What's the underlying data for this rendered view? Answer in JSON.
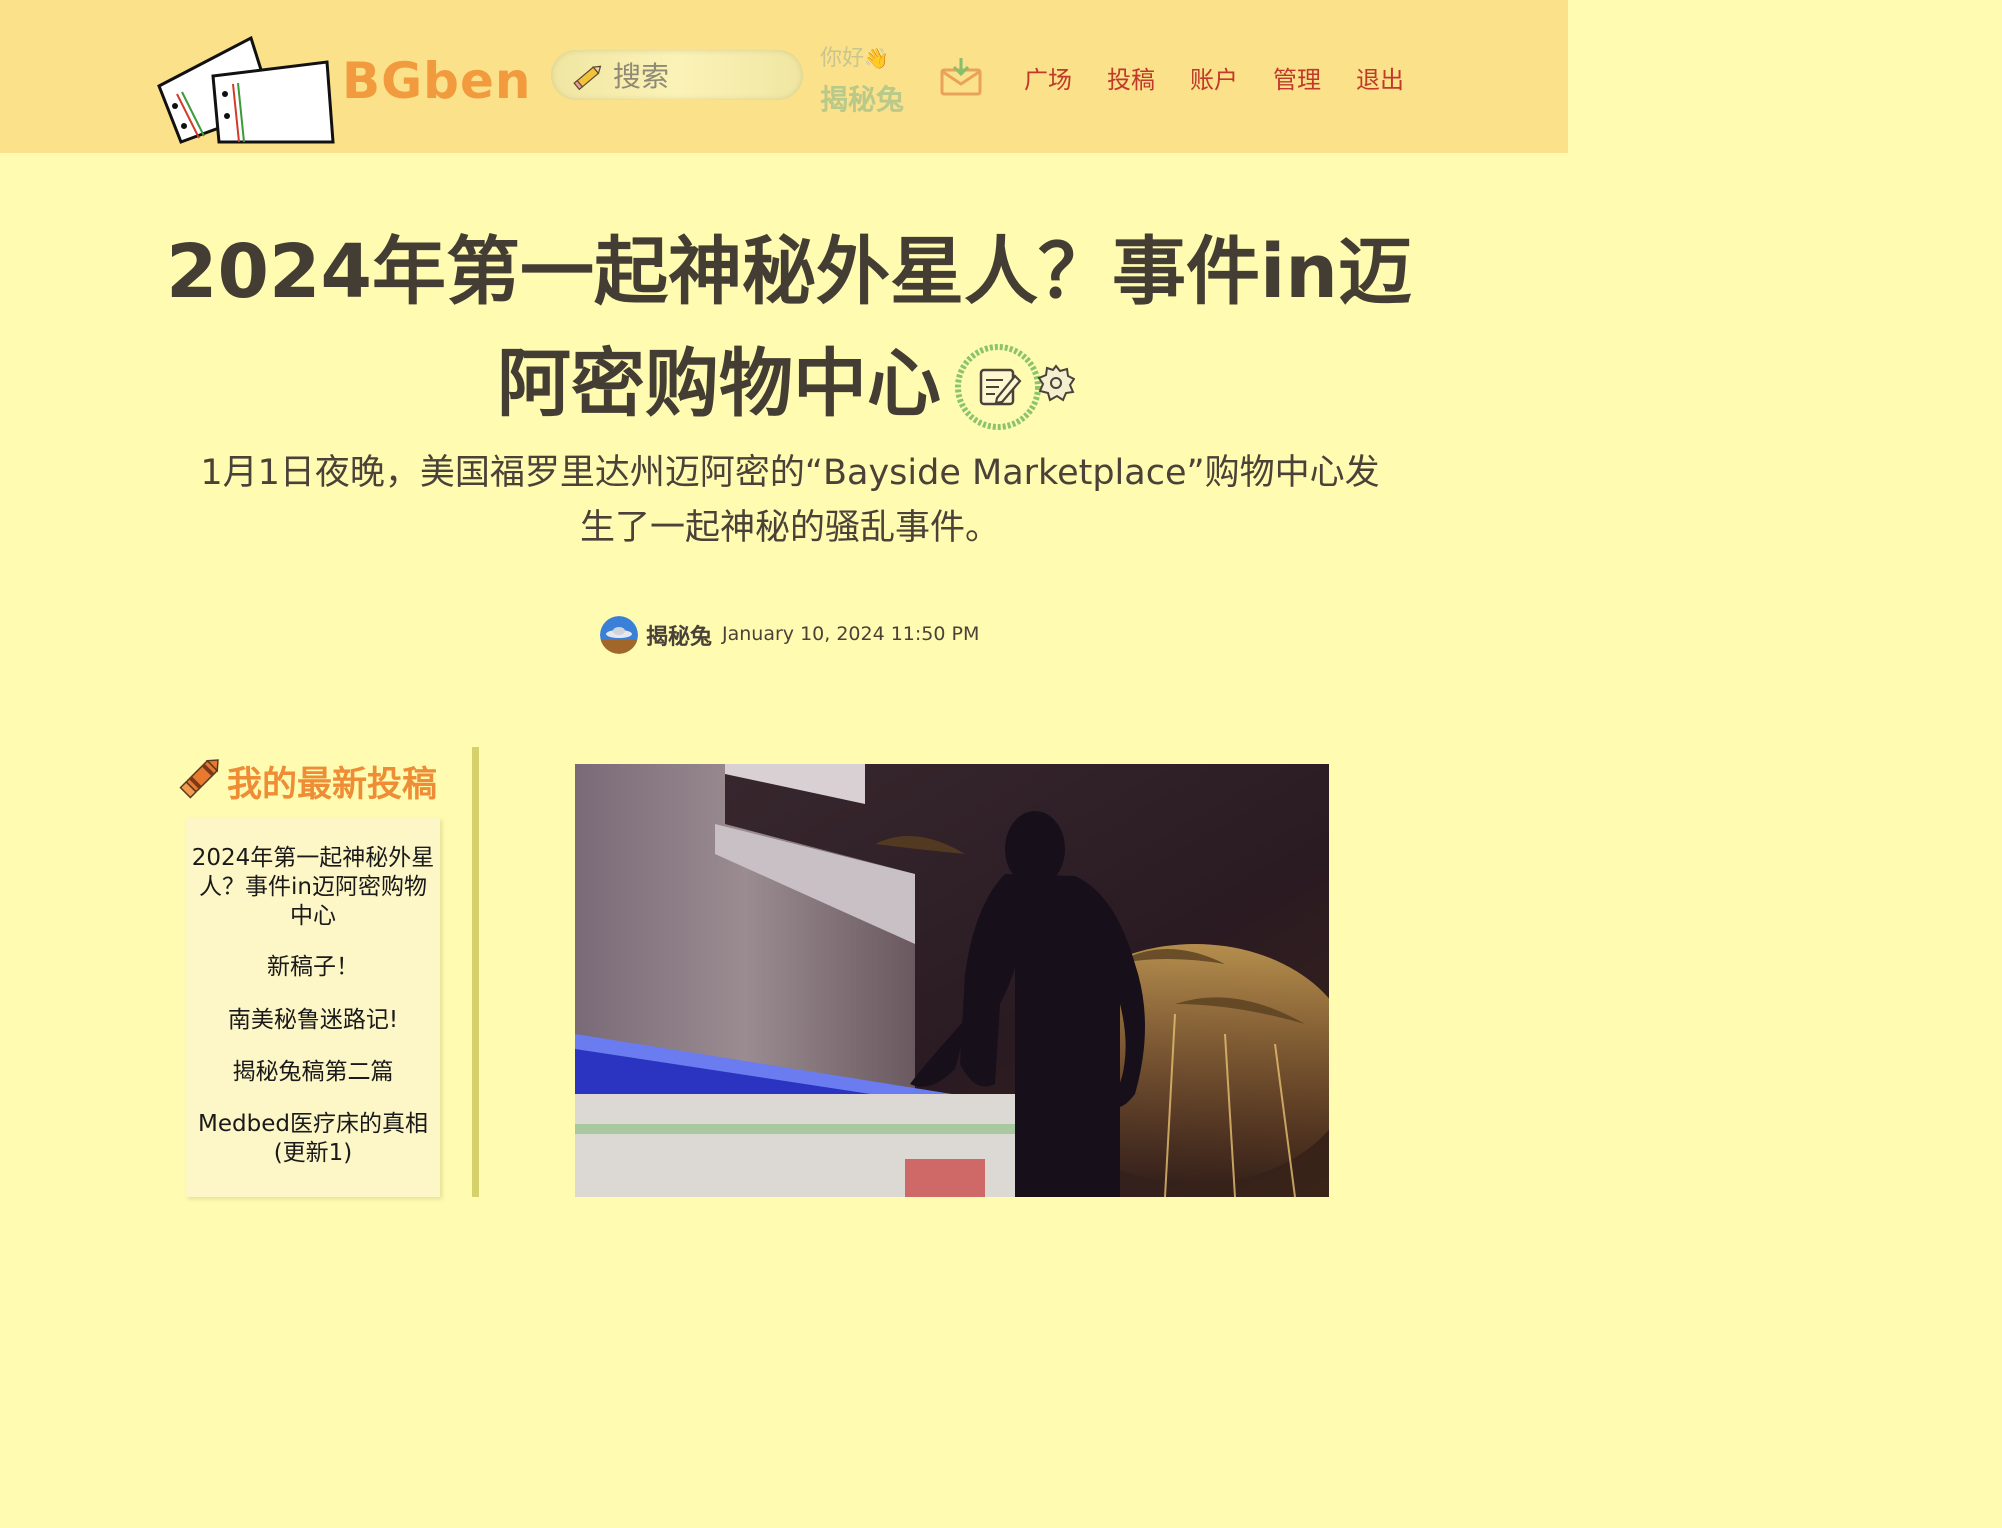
{
  "header": {
    "brand": "BGben",
    "search_placeholder": "搜索",
    "greeting": "你好",
    "username": "揭秘兔",
    "nav": [
      {
        "label": "广场"
      },
      {
        "label": "投稿"
      },
      {
        "label": "账户"
      },
      {
        "label": "管理"
      },
      {
        "label": "退出"
      }
    ],
    "icons": [
      "logo-papers",
      "pencil-icon",
      "wave-icon",
      "mail-icon"
    ]
  },
  "article": {
    "title": "2024年第一起神秘外星人？事件in迈阿密购物中心",
    "subtitle": "1月1日夜晚，美国福罗里达州迈阿密的“Bayside Marketplace”购物中心发生了一起神秘的骚乱事件。",
    "author": "揭秘兔",
    "date": "January 10, 2024 11:50 PM",
    "icons": [
      "edit-icon",
      "gear-icon",
      "avatar"
    ]
  },
  "sidebar": {
    "title": "我的最新投稿",
    "items": [
      {
        "label": "2024年第一起神秘外星人？事件in迈阿密购物中心"
      },
      {
        "label": "新稿子！"
      },
      {
        "label": "南美秘鲁迷路记!"
      },
      {
        "label": "揭秘兔稿第二篇"
      },
      {
        "label": "Medbed医疗床的真相(更新1)"
      }
    ]
  },
  "colors": {
    "page_bg": "#fffbb0",
    "header_bg": "#fbe18a",
    "brand": "#f19a3e",
    "nav_link": "#c0392b",
    "sidebar_title": "#ee8d35",
    "title_text": "#433d34"
  }
}
